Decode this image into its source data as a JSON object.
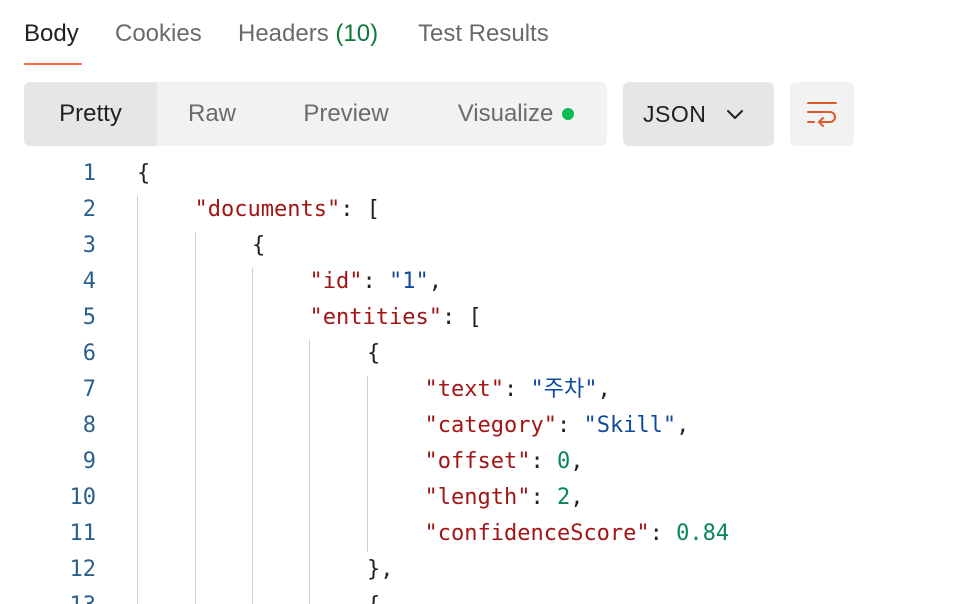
{
  "tabs": {
    "body": "Body",
    "cookies": "Cookies",
    "headers": "Headers",
    "headers_count": "(10)",
    "test_results": "Test Results"
  },
  "view_modes": {
    "pretty": "Pretty",
    "raw": "Raw",
    "preview": "Preview",
    "visualize": "Visualize"
  },
  "format": {
    "selected": "JSON"
  },
  "icons": {
    "dropdown": "chevron-down-icon",
    "wrap": "wrap-lines-icon",
    "visualize_status": "green-dot"
  },
  "colors": {
    "accent": "#ff6c37",
    "active_count": "#0c7a3a",
    "status_dot": "#0cbb52",
    "json_key": "#a31515",
    "json_string": "#0e4a9e",
    "json_number": "#098658",
    "line_number": "#2b5f8c"
  },
  "code": {
    "line_numbers": [
      "1",
      "2",
      "3",
      "4",
      "5",
      "6",
      "7",
      "8",
      "9",
      "10",
      "11",
      "12",
      "13"
    ],
    "lines": [
      [
        {
          "t": "p",
          "v": "{"
        }
      ],
      [
        {
          "t": "k",
          "v": "\"documents\""
        },
        {
          "t": "p",
          "v": ": ["
        }
      ],
      [
        {
          "t": "p",
          "v": "{"
        }
      ],
      [
        {
          "t": "k",
          "v": "\"id\""
        },
        {
          "t": "p",
          "v": ": "
        },
        {
          "t": "s",
          "v": "\"1\""
        },
        {
          "t": "p",
          "v": ","
        }
      ],
      [
        {
          "t": "k",
          "v": "\"entities\""
        },
        {
          "t": "p",
          "v": ": ["
        }
      ],
      [
        {
          "t": "p",
          "v": "{"
        }
      ],
      [
        {
          "t": "k",
          "v": "\"text\""
        },
        {
          "t": "p",
          "v": ": "
        },
        {
          "t": "s",
          "v": "\"주차\""
        },
        {
          "t": "p",
          "v": ","
        }
      ],
      [
        {
          "t": "k",
          "v": "\"category\""
        },
        {
          "t": "p",
          "v": ": "
        },
        {
          "t": "s",
          "v": "\"Skill\""
        },
        {
          "t": "p",
          "v": ","
        }
      ],
      [
        {
          "t": "k",
          "v": "\"offset\""
        },
        {
          "t": "p",
          "v": ": "
        },
        {
          "t": "n",
          "v": "0"
        },
        {
          "t": "p",
          "v": ","
        }
      ],
      [
        {
          "t": "k",
          "v": "\"length\""
        },
        {
          "t": "p",
          "v": ": "
        },
        {
          "t": "n",
          "v": "2"
        },
        {
          "t": "p",
          "v": ","
        }
      ],
      [
        {
          "t": "k",
          "v": "\"confidenceScore\""
        },
        {
          "t": "p",
          "v": ": "
        },
        {
          "t": "n",
          "v": "0.84"
        }
      ],
      [
        {
          "t": "p",
          "v": "},"
        }
      ],
      [
        {
          "t": "p",
          "v": "{"
        }
      ]
    ]
  }
}
